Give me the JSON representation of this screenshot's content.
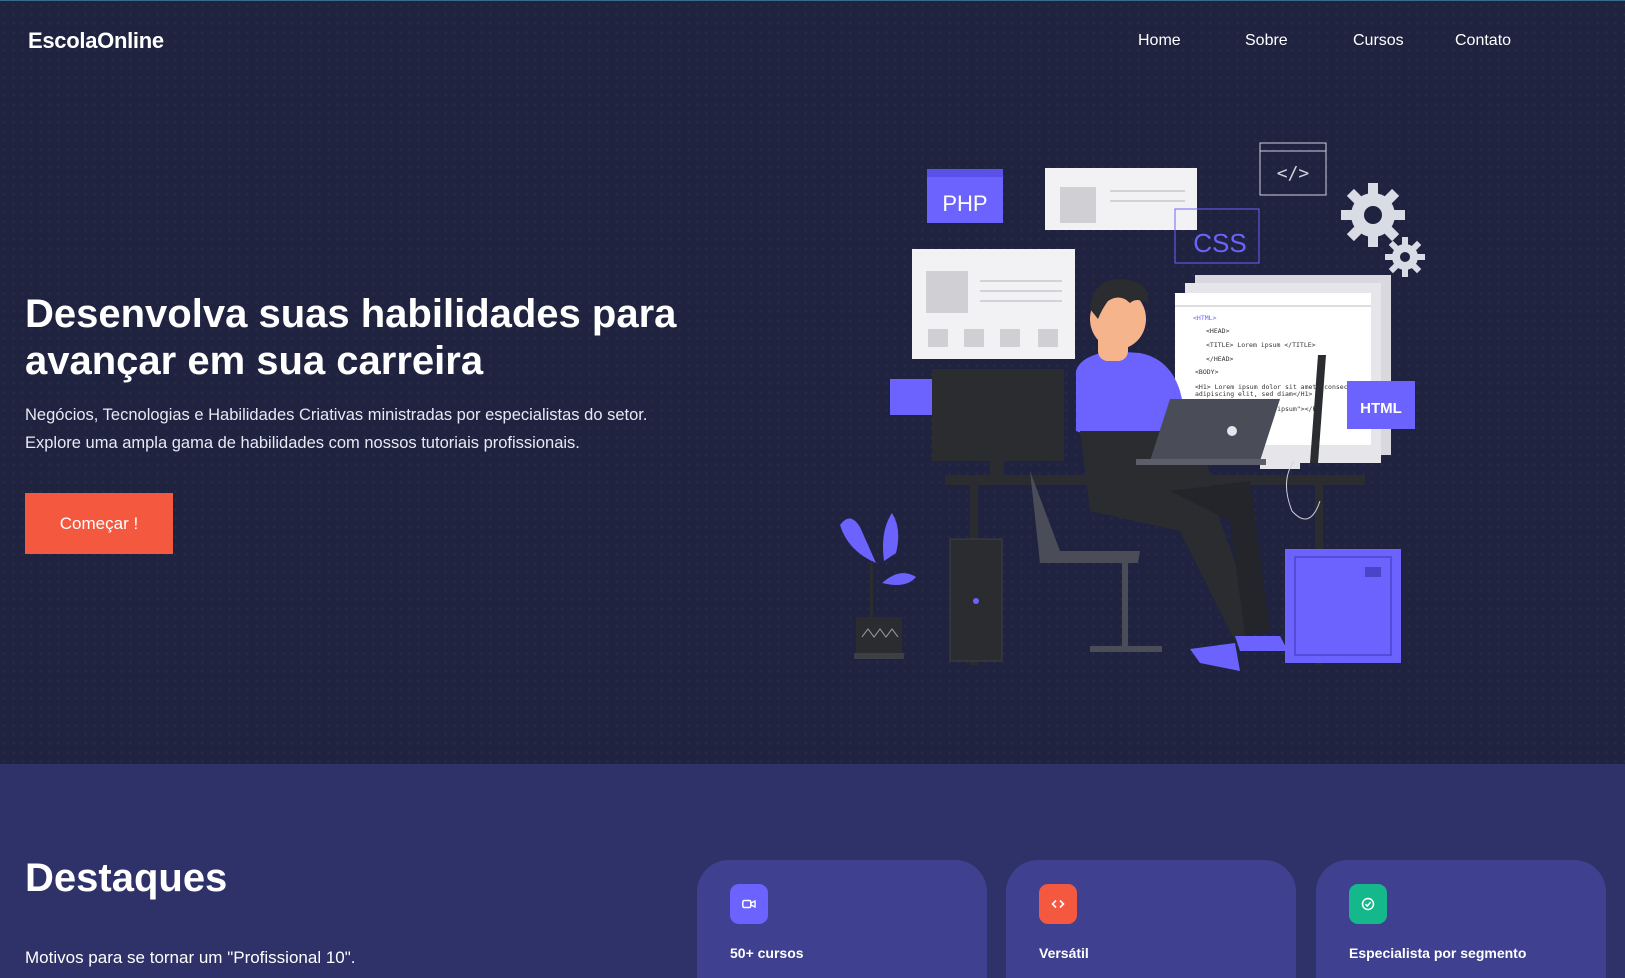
{
  "brand": "EscolaOnline",
  "nav": [
    "Home",
    "Sobre",
    "Cursos",
    "Contato"
  ],
  "hero": {
    "title_line1": "Desenvolva suas habilidades para",
    "title_line2": "avançar em sua carreira",
    "subtitle_line1": "Negócios, Tecnologias e Habilidades Criativas ministradas por especialistas do setor.",
    "subtitle_line2": "Explore uma ampla gama de habilidades com nossos tutoriais profissionais.",
    "cta_label": "Começar !"
  },
  "illustration": {
    "php_label": "PHP",
    "css_label": "CSS",
    "html_label": "HTML",
    "code_lines": [
      "<HTML>",
      "<HEAD>",
      "<TITLE> Lorem ipsum </TITLE>",
      "</HEAD>",
      "<BODY>",
      "<H1> Lorem ipsum dolor sit amet, consectetur",
      "adipiscing elit, sed diam</H1>",
      "<P> <IMG SRC= \"Lorem ipsum\"></P>"
    ]
  },
  "highlights": {
    "title": "Destaques",
    "subtitle": "Motivos para se tornar um \"Profissional 10\".",
    "cards": [
      {
        "title": "50+ cursos",
        "icon": "video-icon",
        "color": "#6c63ff"
      },
      {
        "title": "Versátil",
        "icon": "code-icon",
        "color": "#f4583f"
      },
      {
        "title": "Especialista por segmento",
        "icon": "check-circle-icon",
        "color": "#14b88a"
      }
    ]
  },
  "colors": {
    "hero_bg": "#1f2340",
    "section_bg": "#2f3169",
    "card_bg": "#3f4190",
    "accent": "#f4583f",
    "illustration_purple": "#6c63ff"
  }
}
